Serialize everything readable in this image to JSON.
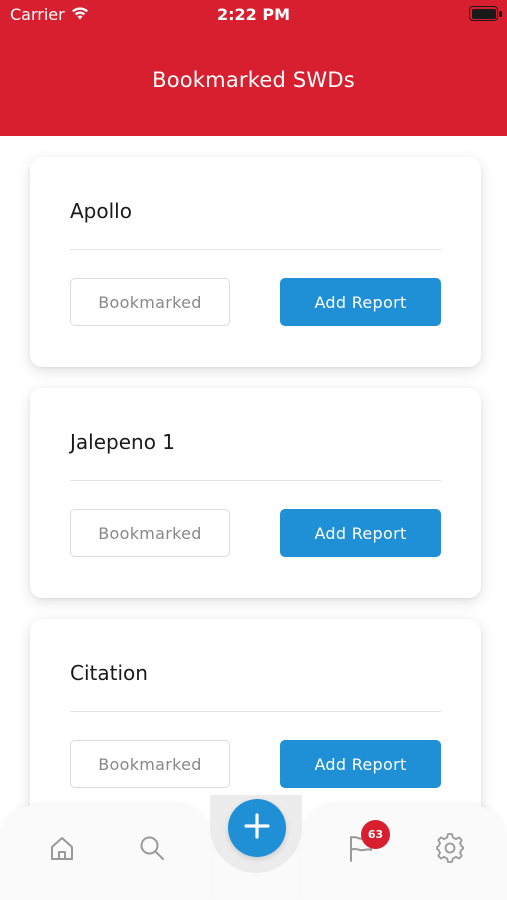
{
  "status_bar": {
    "carrier": "Carrier",
    "time": "2:22 PM",
    "icons": {
      "wifi": "wifi-icon",
      "battery": "battery-icon"
    }
  },
  "header": {
    "title": "Bookmarked SWDs",
    "background_color": "#d71f30"
  },
  "cards": [
    {
      "title": "Apollo",
      "bookmark_label": "Bookmarked",
      "report_label": "Add Report"
    },
    {
      "title": "Jalepeno 1",
      "bookmark_label": "Bookmarked",
      "report_label": "Add Report"
    },
    {
      "title": "Citation",
      "bookmark_label": "Bookmarked",
      "report_label": "Add Report"
    }
  ],
  "tab_bar": {
    "items": [
      {
        "icon": "home-icon"
      },
      {
        "icon": "search-icon"
      },
      {
        "icon": "plus-icon"
      },
      {
        "icon": "flag-icon",
        "badge": "63"
      },
      {
        "icon": "gear-icon"
      }
    ],
    "accent_color": "#1f8fd6",
    "badge_color": "#d71f30"
  }
}
